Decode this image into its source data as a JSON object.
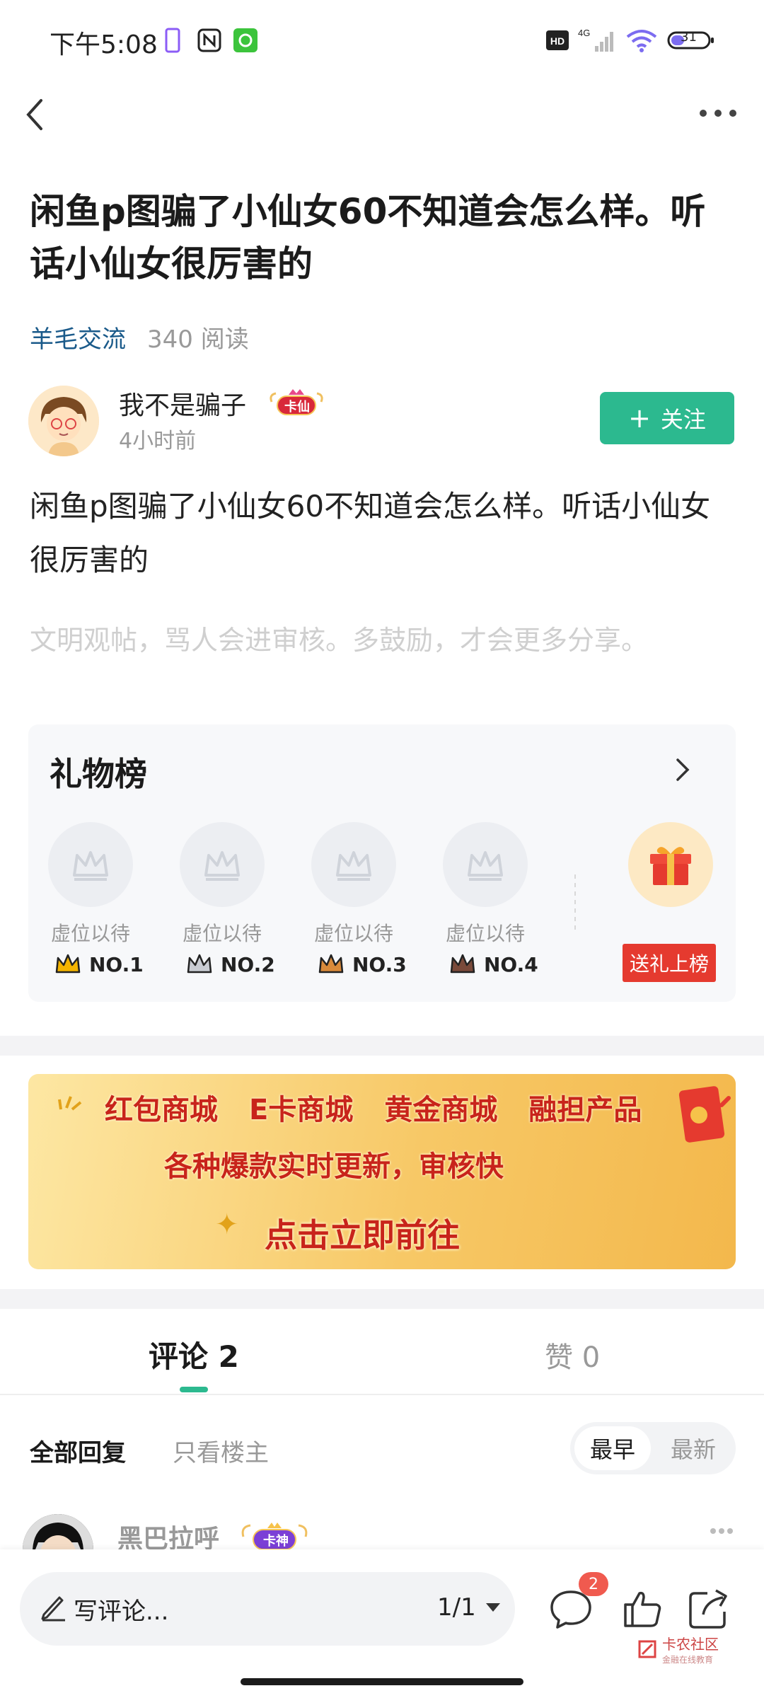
{
  "status_bar": {
    "time": "下午5:08",
    "network": "4G",
    "hd": "HD",
    "battery": "31"
  },
  "post": {
    "title": "闲鱼p图骗了小仙女60不知道会怎么样。听话小仙女很厉害的",
    "category": "羊毛交流",
    "reads": "340 阅读",
    "author": "我不是骗子",
    "author_badge": "卡仙",
    "time_ago": "4小时前",
    "follow_label": "关注",
    "body": "闲鱼p图骗了小仙女60不知道会怎么样。听话小仙女很厉害的",
    "hint": "文明观帖，骂人会进审核。多鼓励，才会更多分享。"
  },
  "gift_board": {
    "title": "礼物榜",
    "slots": [
      {
        "label": "虚位以待",
        "rank": "NO.1",
        "color": "#f4b400"
      },
      {
        "label": "虚位以待",
        "rank": "NO.2",
        "color": "#a0a4ad"
      },
      {
        "label": "虚位以待",
        "rank": "NO.3",
        "color": "#d98a3a"
      },
      {
        "label": "虚位以待",
        "rank": "NO.4",
        "color": "#7a4a3a"
      }
    ],
    "send_label": "送礼上榜"
  },
  "banner": {
    "row1": [
      "红包商城",
      "E卡商城",
      "黄金商城",
      "融担产品"
    ],
    "row2": "各种爆款实时更新，审核快",
    "row3": "点击立即前往"
  },
  "comments": {
    "tab_comments": "评论 2",
    "tab_likes": "赞 0",
    "filter_all": "全部回复",
    "filter_op": "只看楼主",
    "sort_early": "最早",
    "sort_new": "最新",
    "first": {
      "name": "黑巴拉呼",
      "badge": "卡神"
    }
  },
  "bottom_bar": {
    "placeholder": "写评论...",
    "page": "1/1",
    "comment_count": "2",
    "watermark": "卡农社区",
    "watermark_sub": "金融在线教育"
  },
  "colors": {
    "accent": "#2cb98f",
    "link": "#1a5a8a",
    "red": "#e53a2f"
  }
}
